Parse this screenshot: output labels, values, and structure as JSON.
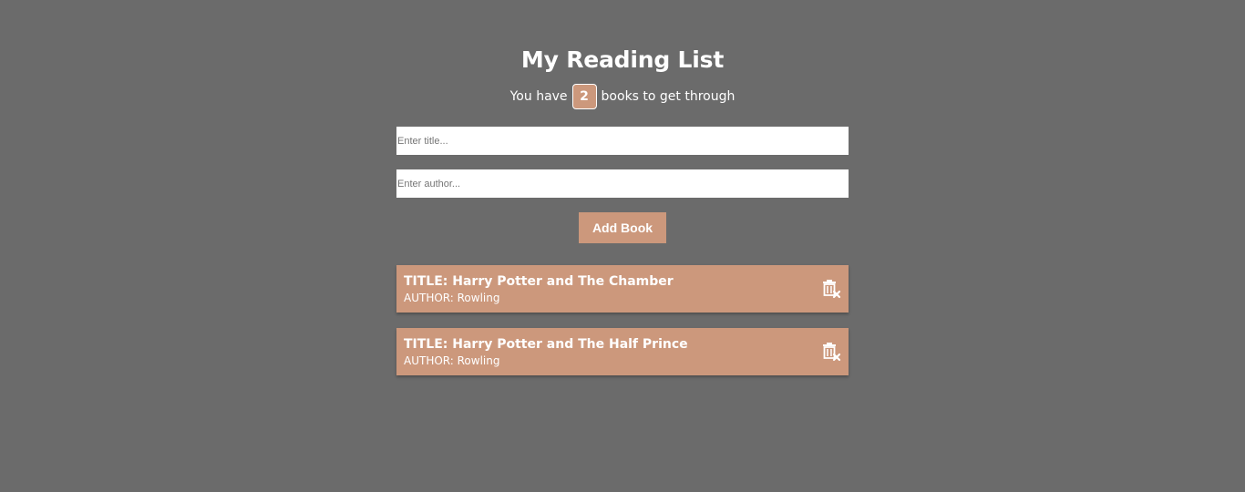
{
  "header": {
    "title": "My Reading List",
    "subtitle_prefix": "You have",
    "count": "2",
    "subtitle_suffix": "books to get through"
  },
  "form": {
    "title_placeholder": "Enter title...",
    "author_placeholder": "Enter author...",
    "title_value": "",
    "author_value": "",
    "add_label": "Add Book"
  },
  "books": [
    {
      "title": "TITLE: Harry Potter and The Chamber",
      "author": "AUTHOR: Rowling",
      "delete_icon": "trash-delete-icon"
    },
    {
      "title": "TITLE: Harry Potter and The Half Prince",
      "author": "AUTHOR: Rowling",
      "delete_icon": "trash-delete-icon"
    }
  ],
  "colors": {
    "background": "#6b6b6b",
    "accent": "#cc987c",
    "text": "#ffffff"
  }
}
